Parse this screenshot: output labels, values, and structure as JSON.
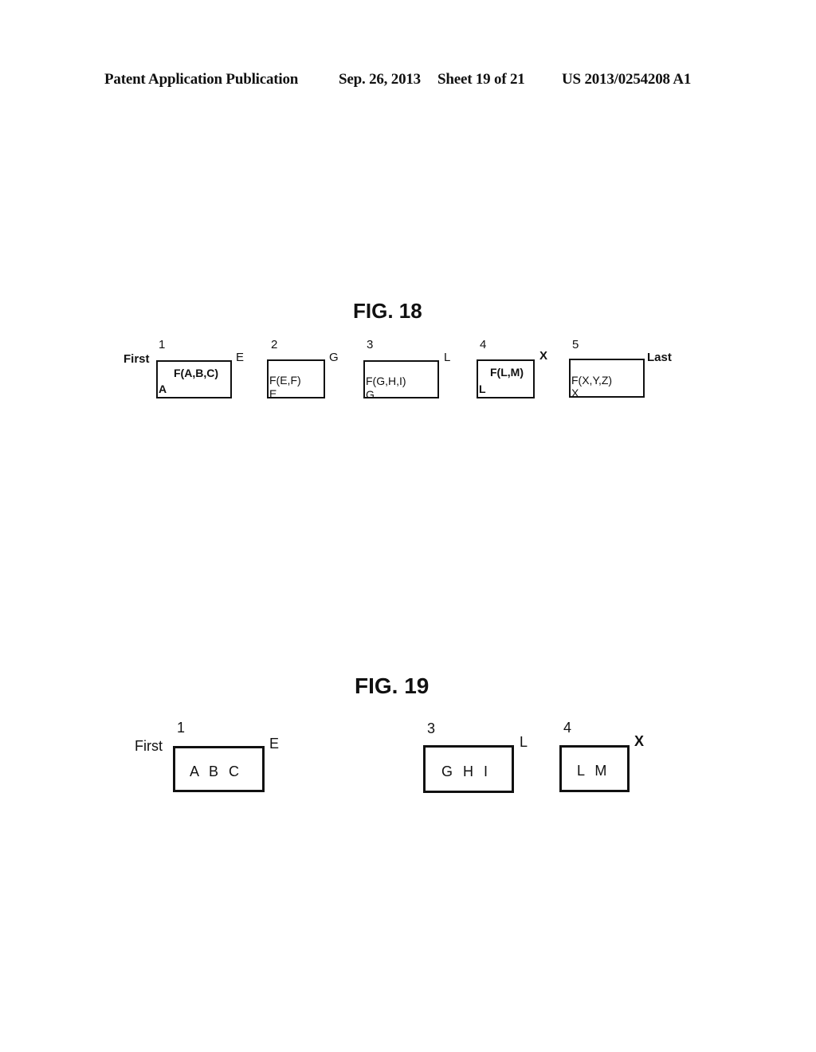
{
  "header": {
    "publication": "Patent Application Publication",
    "date": "Sep. 26, 2013",
    "sheet": "Sheet 19 of 21",
    "number": "US 2013/0254208 A1"
  },
  "fig18": {
    "title": "FIG. 18",
    "first_label": "First",
    "last_label": "Last",
    "boxes": [
      {
        "index": "1",
        "function": "F(A,B,C)",
        "start": "A",
        "end": "E"
      },
      {
        "index": "2",
        "function": "F(E,F)",
        "start": "E",
        "end": "G"
      },
      {
        "index": "3",
        "function": "F(G,H,I)",
        "start": "G",
        "end": "L"
      },
      {
        "index": "4",
        "function": "F(L,M)",
        "start": "L",
        "end": "X"
      },
      {
        "index": "5",
        "function": "F(X,Y,Z)",
        "start": "X",
        "end": "Last"
      }
    ]
  },
  "fig19": {
    "title": "FIG. 19",
    "first_label": "First",
    "boxes": [
      {
        "index": "1",
        "contents": "A B C",
        "end": "E"
      },
      {
        "index": "3",
        "contents": "G H I",
        "end": "L"
      },
      {
        "index": "4",
        "contents": "L M",
        "end": "X"
      }
    ]
  }
}
